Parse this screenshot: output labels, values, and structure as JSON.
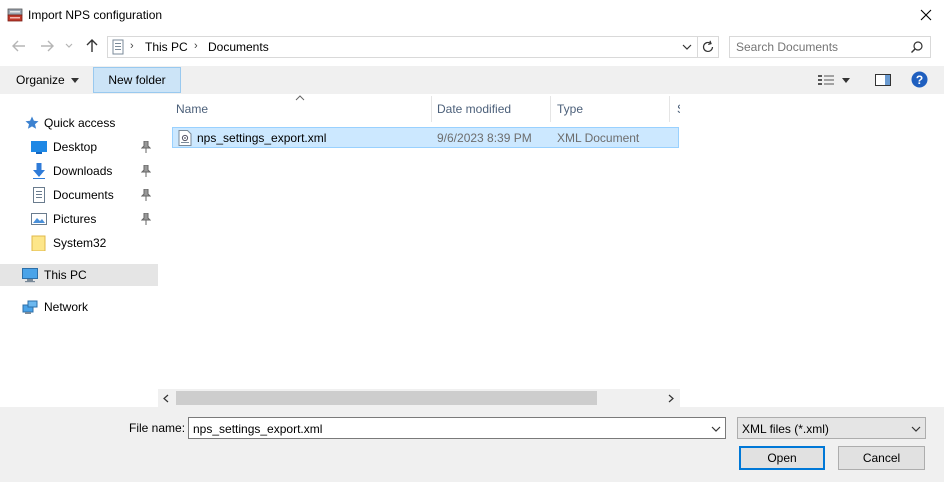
{
  "window": {
    "title": "Import NPS configuration"
  },
  "address": {
    "crumbs": [
      "This PC",
      "Documents"
    ]
  },
  "search": {
    "placeholder": "Search Documents"
  },
  "toolbar": {
    "organize_label": "Organize",
    "new_folder_label": "New folder"
  },
  "nav": {
    "quick_access": "Quick access",
    "items": [
      {
        "label": "Desktop",
        "pinned": true
      },
      {
        "label": "Downloads",
        "pinned": true
      },
      {
        "label": "Documents",
        "pinned": true
      },
      {
        "label": "Pictures",
        "pinned": true
      },
      {
        "label": "System32",
        "pinned": false
      }
    ],
    "this_pc": "This PC",
    "network": "Network"
  },
  "columns": {
    "name": "Name",
    "date_modified": "Date modified",
    "type": "Type"
  },
  "files": [
    {
      "name": "nps_settings_export.xml",
      "date": "9/6/2023 8:39 PM",
      "type": "XML Document"
    }
  ],
  "bottom": {
    "file_name_label": "File name:",
    "file_name_value": "nps_settings_export.xml",
    "file_type_value": "XML files (*.xml)",
    "open_label": "Open",
    "cancel_label": "Cancel"
  }
}
